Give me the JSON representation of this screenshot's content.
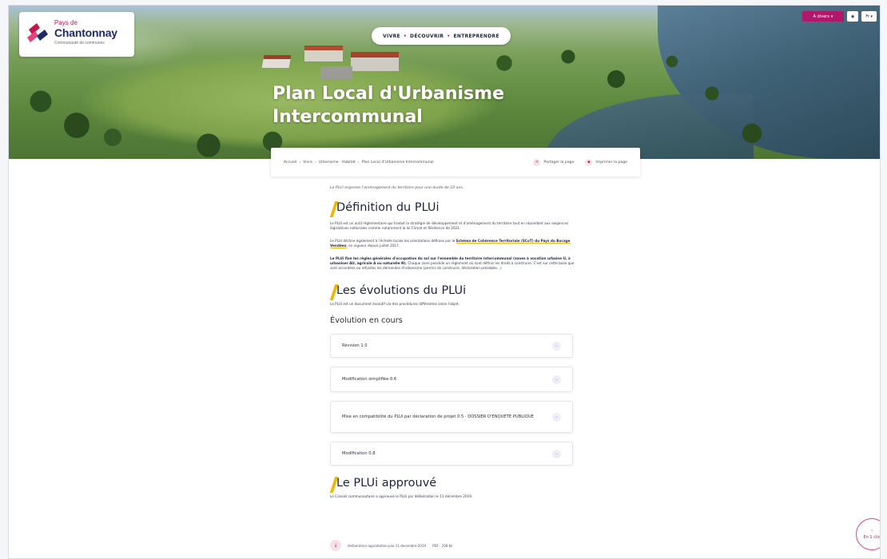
{
  "logo": {
    "line1": "Pays de",
    "line2": "Chantonnay",
    "line3": "Communauté de communes"
  },
  "nav": {
    "items": [
      "VIVRE",
      "DÉCOUVRIR",
      "ENTREPRENDRE"
    ],
    "sep": "•"
  },
  "topbar": {
    "adrom_label": "À divers",
    "eye_label": "◉",
    "lang_label": "Fr"
  },
  "hero": {
    "title_line1": "Plan Local d'Urbanisme",
    "title_line2": "Intercommunal"
  },
  "breadcrumb": {
    "items": [
      "Accueil",
      "Vivre",
      "Urbanisme · Habitat",
      "Plan Local d'Urbanisme Intercommunal"
    ],
    "sep": "›",
    "share_label": "Partager la page",
    "print_label": "Imprimer la page"
  },
  "content": {
    "intro": "Le PLUi organise l'aménagement du territoire pour une durée de 10 ans.",
    "section1": {
      "title": "Définition du PLUi",
      "p1": "Le PLUi est un outil réglementaire qui traduit la stratégie de développement et d'aménagement du territoire tout en répondant aux exigences législatives nationales comme notamment la loi Climat et Résilience de 2021.",
      "p2_pre": "Le PLUi décline également à l'échelle locale les orientations définies par le ",
      "p2_link": "Schéma de Cohérence Territoriale (SCoT) du Pays du Bocage Vendéen",
      "p2_post": ", en vigueur depuis juillet 2017.",
      "p3_bold": "Le PLUi fixe les règles générales d'occupation du sol sur l'ensemble du territoire intercommunal (zones à vocation urbaine U, à urbaniser AU, agricole A ou naturelle N).",
      "p3_rest": " Chaque zone possède un règlement où sont définis les droits à construire. C'est sur cette base que sont accordées ou refusées les demandes d'urbanisme (permis de construire, déclaration préalable…)"
    },
    "section2": {
      "title": "Les évolutions du PLUi",
      "intro": "Le PLUi est un document évolutif via des procédures différentes selon l'objet.",
      "subtitle": "Évolution en cours",
      "accordions": [
        "Révision 1.0",
        "Modification simplifiée 0.6",
        "Mise en compatibilité du PLUi par déclaration de projet 0.5 · DOSSIER D'ENQUETE PUBLIQUE",
        "Modification 0.8"
      ]
    },
    "section3": {
      "title": "Le PLUi approuvé",
      "intro": "Le Conseil communautaire a approuvé le PLUi par délibération le 11 décembre 2019.",
      "file_label": "deliberation-approbation-plui-11-decembre-2019",
      "file_meta": "PDF · 208 Ko"
    }
  },
  "floating": {
    "label": "En 1 clic"
  },
  "colors": {
    "accent": "#b6224f",
    "brand_navy": "#1f2340",
    "highlight": "#f2b705",
    "button_magenta": "#b0196b"
  }
}
